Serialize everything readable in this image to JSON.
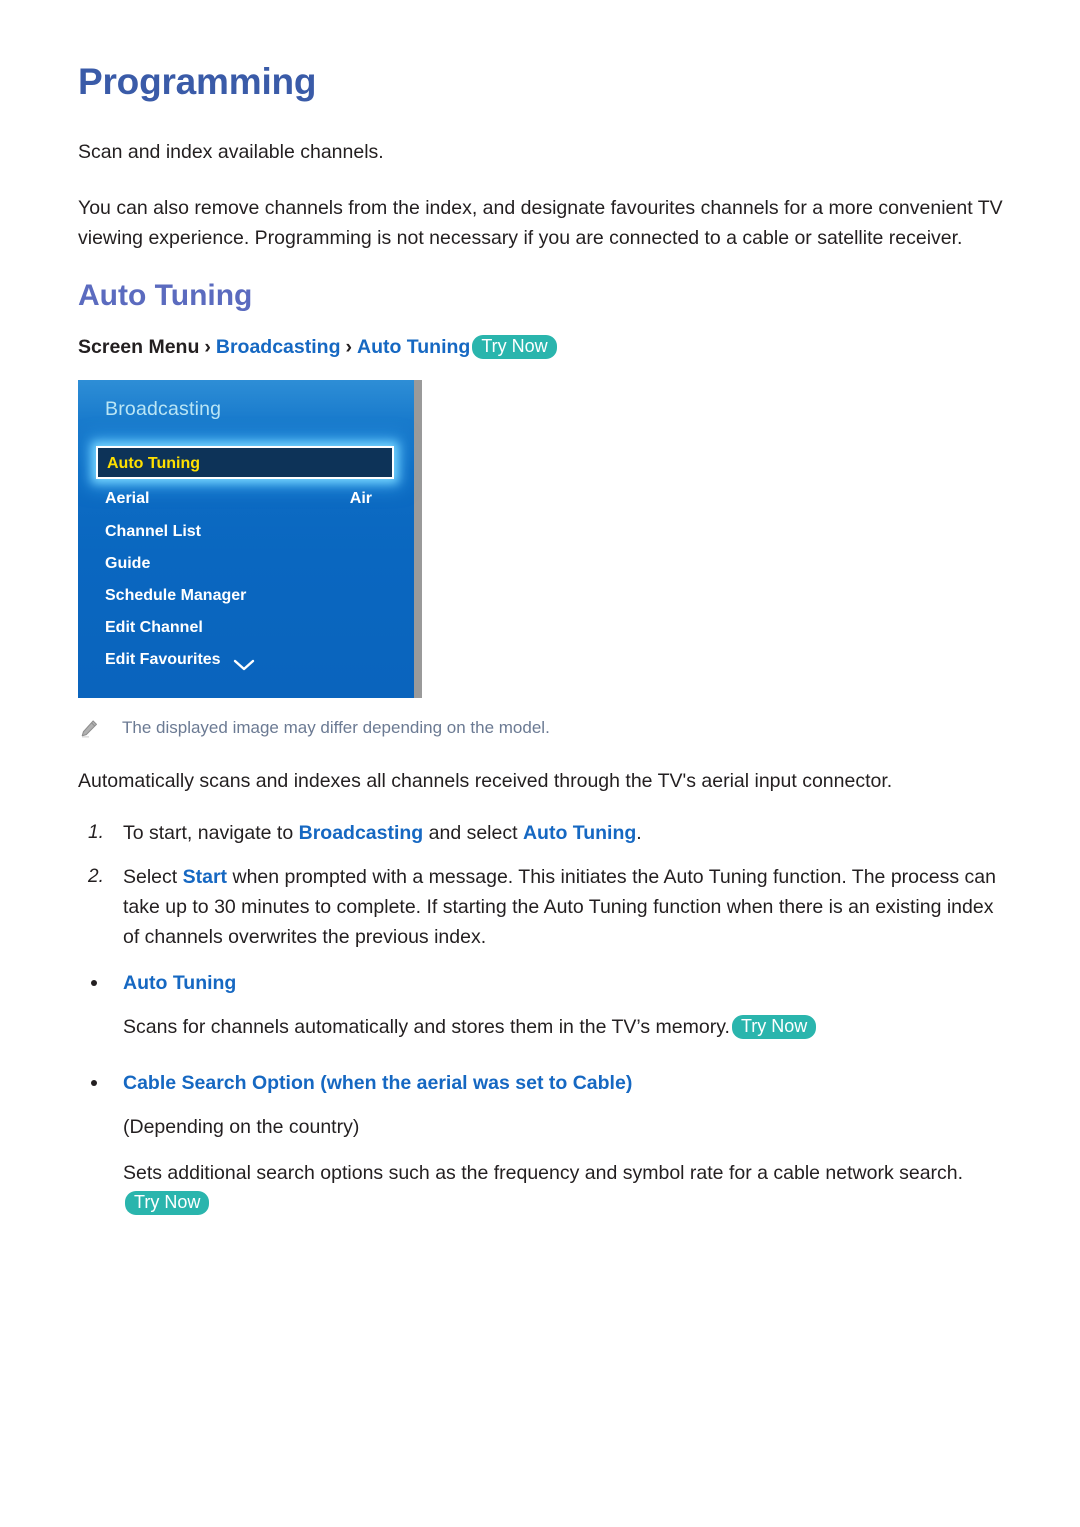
{
  "page": {
    "title": "Programming",
    "intro_1": "Scan and index available channels.",
    "intro_2": "You can also remove channels from the index, and designate favourites channels for a more convenient TV viewing experience. Programming is not necessary if you are connected to a cable or satellite receiver."
  },
  "section": {
    "title": "Auto Tuning",
    "breadcrumb": {
      "screen_menu": "Screen Menu",
      "sep_1": "›",
      "broadcasting": "Broadcasting",
      "sep_2": "›",
      "auto_tuning": "Auto Tuning",
      "try_now": "Try Now"
    }
  },
  "tv_menu": {
    "header": "Broadcasting",
    "selected_item": "Auto Tuning",
    "chevron_icon": "chevron-down-icon",
    "items": [
      {
        "label": "Aerial",
        "value": "Air"
      },
      {
        "label": "Channel List",
        "value": ""
      },
      {
        "label": "Guide",
        "value": ""
      },
      {
        "label": "Schedule Manager",
        "value": ""
      },
      {
        "label": "Edit Channel",
        "value": ""
      },
      {
        "label": "Edit Favourites",
        "value": ""
      }
    ],
    "colors": {
      "background": "#0a67c0",
      "header_text": "#b9e5f5",
      "selected_fill": "#0d3358",
      "selected_text": "#ffe000",
      "selected_glow": "#78d7ff"
    }
  },
  "note": {
    "icon": "pencil-icon",
    "text": "The displayed image may differ depending on the model."
  },
  "description": "Automatically scans and indexes all channels received through the TV's aerial input connector.",
  "steps": [
    {
      "num": "1.",
      "parts": [
        {
          "t": "To start, navigate to ",
          "link": false
        },
        {
          "t": "Broadcasting",
          "link": true
        },
        {
          "t": " and select ",
          "link": false
        },
        {
          "t": "Auto Tuning",
          "link": true
        },
        {
          "t": ".",
          "link": false
        }
      ]
    },
    {
      "num": "2.",
      "parts": [
        {
          "t": "Select ",
          "link": false
        },
        {
          "t": "Start",
          "link": true
        },
        {
          "t": " when prompted with a message. This initiates the Auto Tuning function. The process can take up to 30 minutes to complete. If starting the Auto Tuning function when there is an existing index of channels overwrites the previous index.",
          "link": false
        }
      ]
    }
  ],
  "bullets": [
    {
      "title": "Auto Tuning",
      "title_suffix": "",
      "body": "Scans for channels automatically and stores them in the TV’s memory.",
      "try_now": "Try Now",
      "sub_note": ""
    },
    {
      "title": "Cable Search Option",
      "title_suffix_pre": " (when the aerial was set to ",
      "title_link_2": "Cable",
      "title_suffix_post": ")",
      "sub_note": "(Depending on the country)",
      "body": "Sets additional search options such as the frequency and symbol rate for a cable network search.",
      "try_now": "Try Now"
    }
  ],
  "colors": {
    "page_title": "#3a5ba8",
    "section_title": "#5b6bbf",
    "link": "#1668c2",
    "try_now_bg": "#2ab5ad",
    "note_text": "#6b7a93"
  }
}
